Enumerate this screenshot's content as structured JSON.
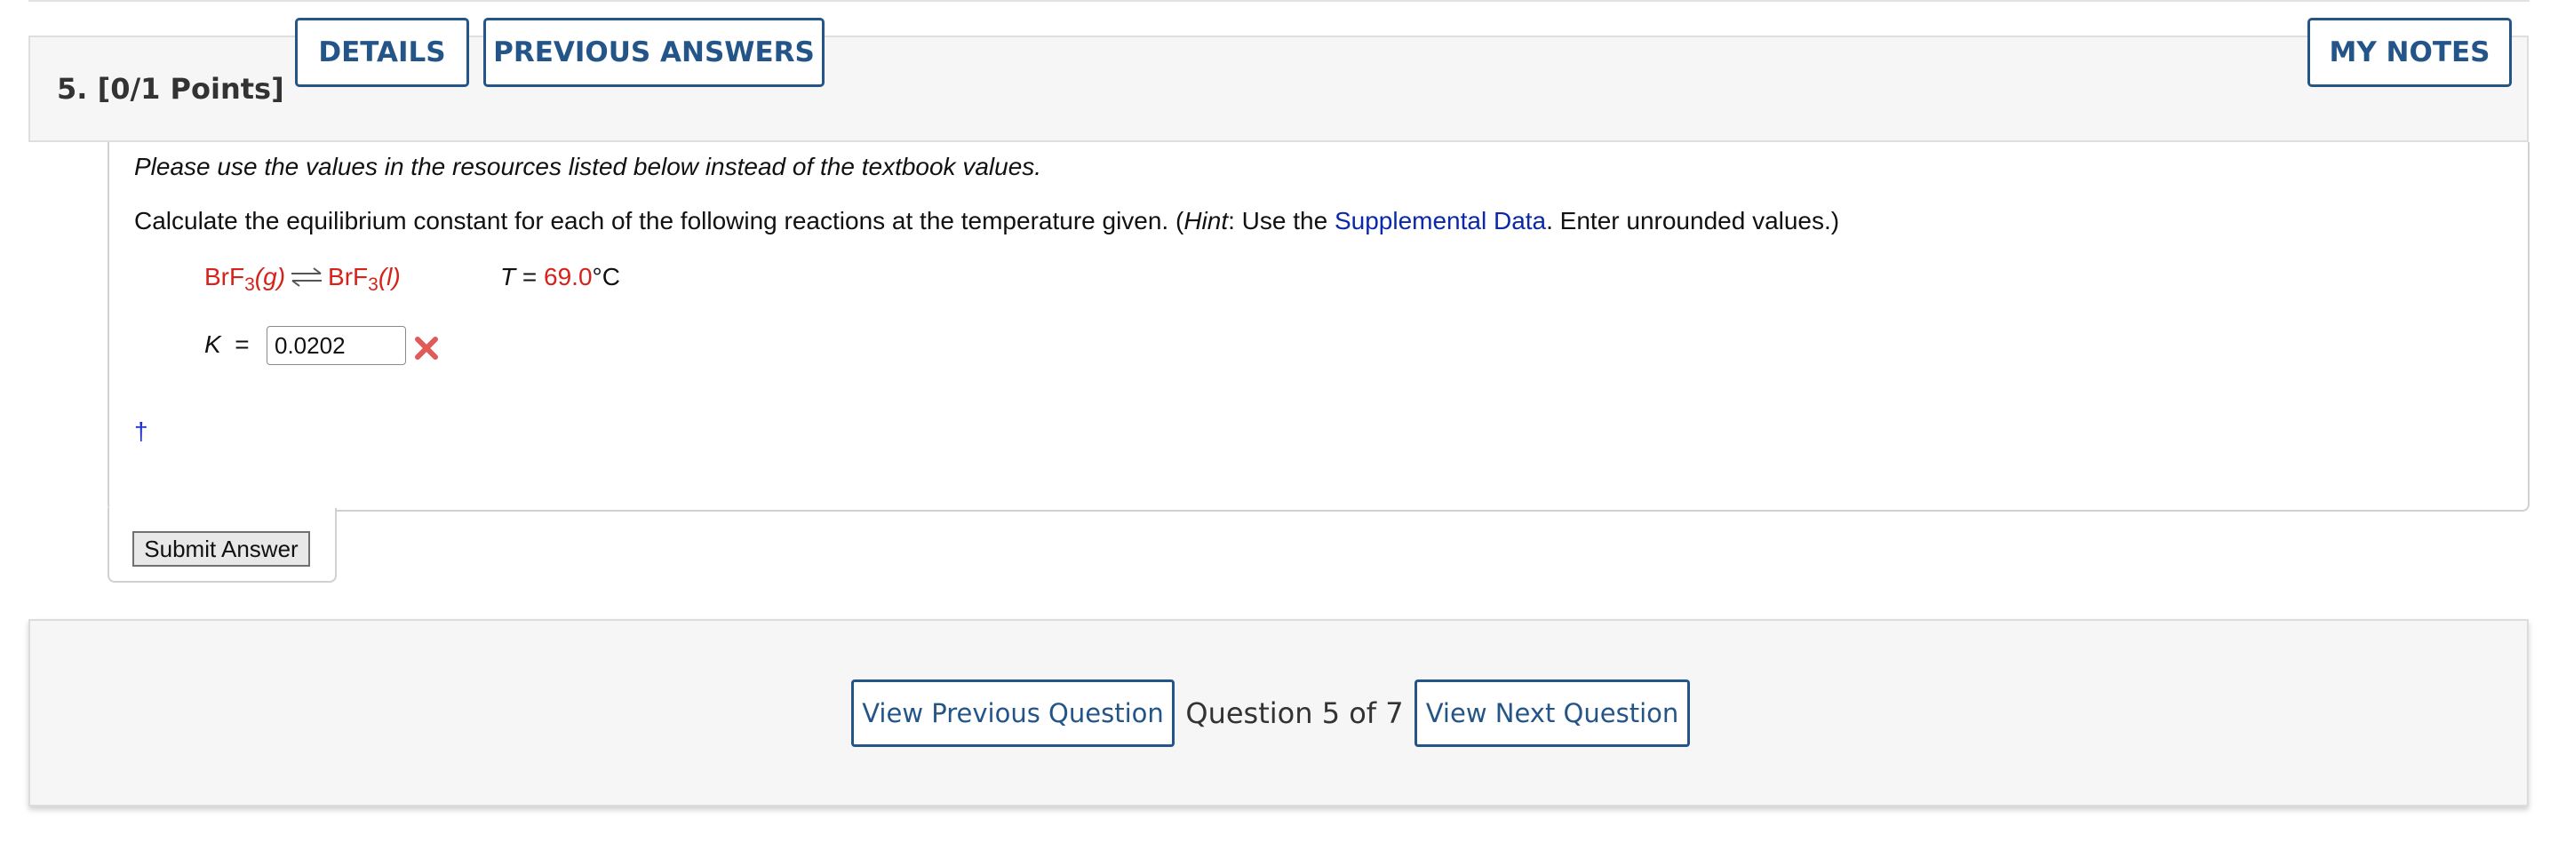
{
  "question": {
    "number_points": "5. [0/1 Points]",
    "details_label": "DETAILS",
    "previous_answers_label": "PREVIOUS ANSWERS",
    "my_notes_label": "MY NOTES"
  },
  "body": {
    "instruction": "Please use the values in the resources listed below instead of the textbook values.",
    "prompt_pre": "Calculate the equilibrium constant for each of the following reactions at the temperature given. (",
    "prompt_hint": "Hint",
    "prompt_mid": ": Use the ",
    "prompt_link": "Supplemental Data",
    "prompt_post": ". Enter unrounded values.)",
    "reaction": {
      "left_formula": "BrF",
      "left_sub": "3",
      "left_state": "(g)",
      "right_formula": "BrF",
      "right_sub": "3",
      "right_state": "(l)"
    },
    "temperature": {
      "symbol": "T",
      "equals": " = ",
      "value": "69.0",
      "unit": "°C"
    },
    "k_label": "K",
    "k_equals": "=",
    "k_value": "0.0202",
    "k_status": "incorrect",
    "dagger": "†",
    "submit_label": "Submit Answer"
  },
  "footer": {
    "prev_label": "View Previous Question",
    "counter": "Question 5 of 7",
    "next_label": "View Next Question"
  },
  "colors": {
    "accent": "#245588",
    "red": "#d6221a",
    "link": "#0a28a8",
    "error_x": "#e05a5a"
  }
}
